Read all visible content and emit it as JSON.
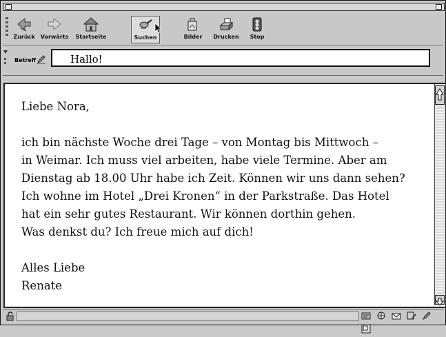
{
  "toolbar": {
    "back": "Zurück",
    "forward": "Vorwärts",
    "home": "Startseite",
    "search": "Suchen",
    "images": "Bilder",
    "print": "Drucken",
    "stop": "Stop"
  },
  "subject": {
    "label": "Betreff",
    "value": "Hallo!"
  },
  "message": {
    "greeting": "Liebe Nora,",
    "lines": [
      "ich bin nächste Woche drei Tage – von Montag bis Mittwoch –",
      "in Weimar. Ich muss viel arbeiten, habe viele Termine. Aber am",
      "Dienstag ab 18.00 Uhr habe ich Zeit. Können wir uns dann sehen?",
      "Ich wohne im Hotel „Drei Kronen“ in der Parkstraße. Das Hotel",
      "hat ein sehr gutes Restaurant. Wir können dorthin gehen.",
      "Was denkst du? Ich freue mich auf dich!"
    ],
    "closing": "Alles Liebe",
    "signature": "Renate"
  },
  "icons": {
    "back": "arrow-left-icon",
    "forward": "arrow-right-icon",
    "home": "house-icon",
    "search": "magnifier-icon",
    "images": "images-icon",
    "print": "printer-icon",
    "stop": "stop-icon",
    "subject": "pen-icon",
    "lock": "lock-icon"
  }
}
